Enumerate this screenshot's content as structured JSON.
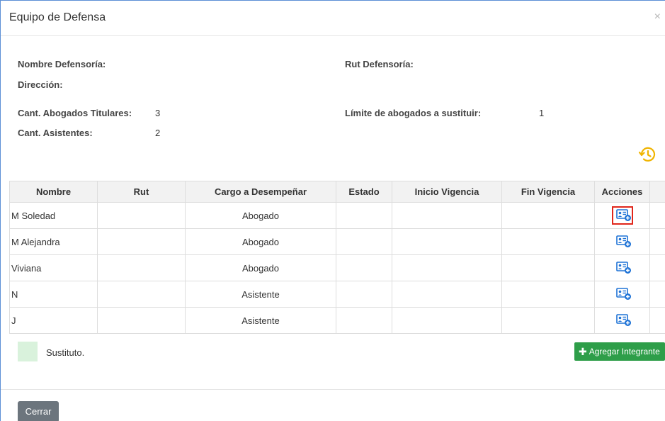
{
  "modal": {
    "title": "Equipo de Defensa",
    "close_glyph": "×"
  },
  "info": {
    "nombre_defensoria_label": "Nombre Defensoría:",
    "rut_defensoria_label": "Rut Defensoría:",
    "direccion_label": "Dirección:",
    "cant_titulares_label": "Cant. Abogados Titulares:",
    "cant_titulares_value": "3",
    "limite_label": "Límite de abogados a sustituir:",
    "limite_value": "1",
    "cant_asistentes_label": "Cant. Asistentes:",
    "cant_asistentes_value": "2"
  },
  "history_icon": {
    "name": "history-icon",
    "color": "#f0b400"
  },
  "table": {
    "headers": [
      "Nombre",
      "Rut",
      "Cargo a Desempeñar",
      "Estado",
      "Inicio Vigencia",
      "Fin Vigencia",
      "Acciones"
    ],
    "rows": [
      {
        "nombre": "M Soledad",
        "rut": "",
        "cargo": "Abogado",
        "estado": "",
        "inicio": "",
        "fin": "",
        "highlighted": true
      },
      {
        "nombre": "M Alejandra",
        "rut": "",
        "cargo": "Abogado",
        "estado": "",
        "inicio": "",
        "fin": "",
        "highlighted": false
      },
      {
        "nombre": "Viviana",
        "rut": "",
        "cargo": "Abogado",
        "estado": "",
        "inicio": "",
        "fin": "",
        "highlighted": false
      },
      {
        "nombre": "N",
        "rut": "",
        "cargo": "Asistente",
        "estado": "",
        "inicio": "",
        "fin": "",
        "highlighted": false
      },
      {
        "nombre": "J",
        "rut": "",
        "cargo": "Asistente",
        "estado": "",
        "inicio": "",
        "fin": "",
        "highlighted": false
      }
    ],
    "action_icon": "add-user-card-icon"
  },
  "legend": {
    "label": "Sustituto.",
    "swatch_color": "#d9f2dc"
  },
  "buttons": {
    "add_label": "Agregar Integrante",
    "add_color": "#2e9e49",
    "close_label": "Cerrar",
    "close_color": "#6c757d"
  },
  "colors": {
    "accent_blue": "#1f73d6",
    "highlight_red": "#e0261b"
  }
}
